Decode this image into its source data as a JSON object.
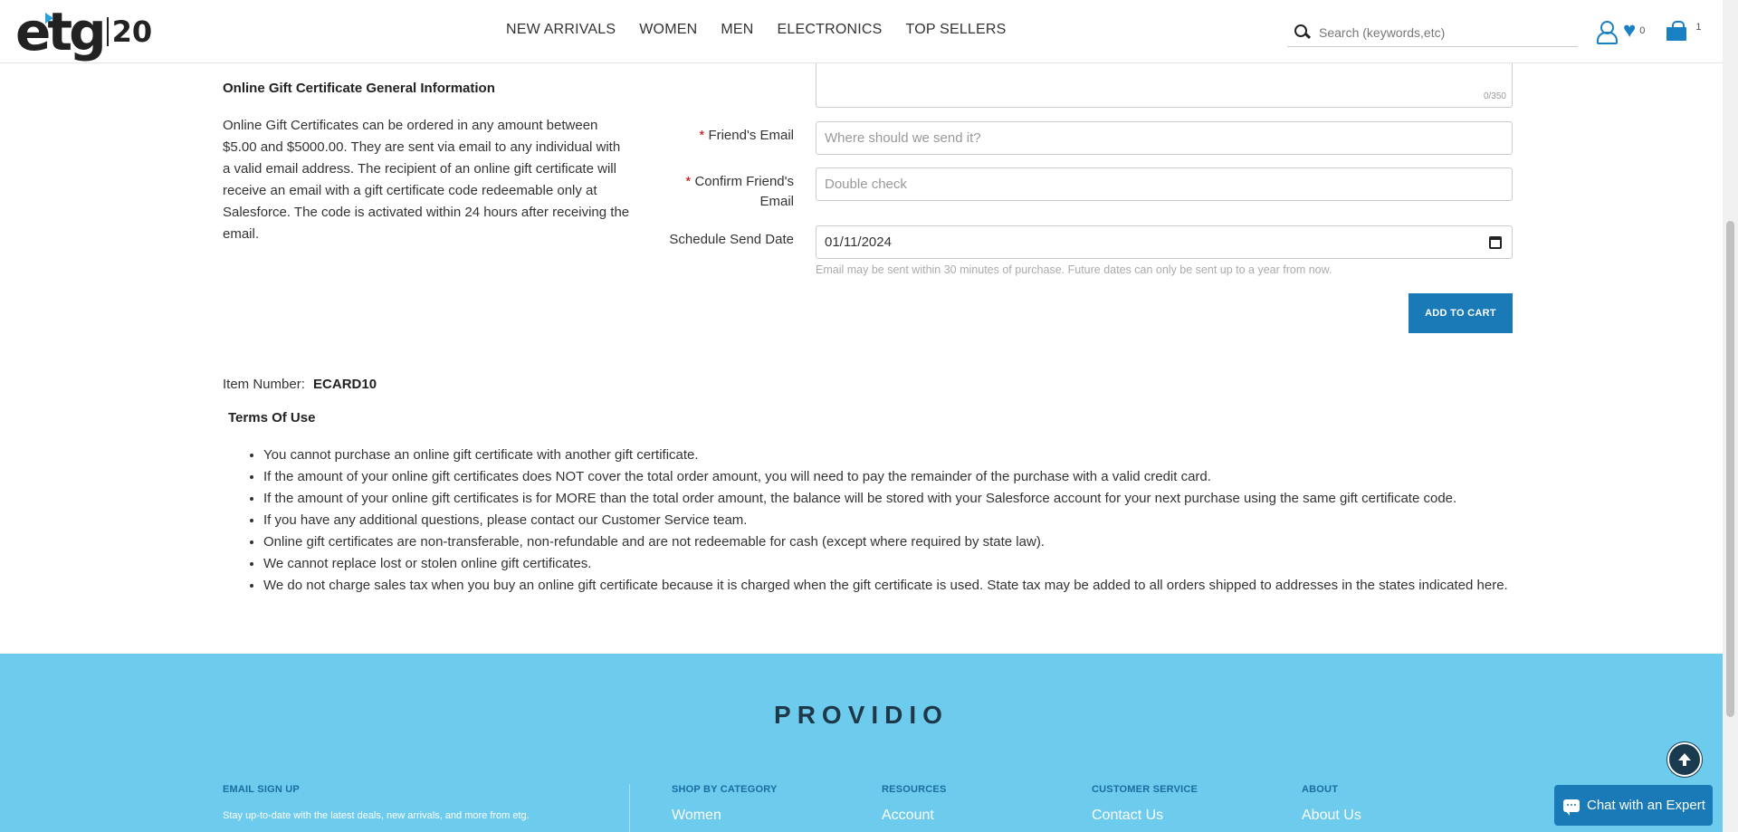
{
  "header": {
    "logo_text": "etg",
    "logo_badge": "20",
    "nav": [
      "NEW ARRIVALS",
      "WOMEN",
      "MEN",
      "ELECTRONICS",
      "TOP SELLERS"
    ],
    "search_placeholder": "Search (keywords,etc)",
    "wishlist_count": "0",
    "cart_count": "1"
  },
  "info": {
    "title": "Online Gift Certificate General Information",
    "text": "Online Gift Certificates can be ordered in any amount between $5.00 and $5000.00. They are sent via email to any individual with a valid email address. The recipient of an online gift certificate will receive an email with a gift certificate code redeemable only at Salesforce. The code is activated within 24 hours after receiving the email."
  },
  "form": {
    "char_count": "0/350",
    "friends_email_label": "Friend's Email",
    "friends_email_placeholder": "Where should we send it?",
    "confirm_email_label": "Confirm Friend's Email",
    "confirm_email_placeholder": "Double check",
    "schedule_label": "Schedule Send Date",
    "schedule_value": "01/11/2024",
    "hint": "Email may be sent within 30 minutes of purchase. Future dates can only be sent up to a year from now.",
    "add_to_cart": "ADD TO CART",
    "required_mark": "*"
  },
  "item": {
    "label": "Item Number:",
    "number": "ECARD10"
  },
  "terms": {
    "title": "Terms Of Use",
    "items": [
      "You cannot purchase an online gift certificate with another gift certificate.",
      "If the amount of your online gift certificates does NOT cover the total order amount, you will need to pay the remainder of the purchase with a valid credit card.",
      "If the amount of your online gift certificates is for MORE than the total order amount, the balance will be stored with your Salesforce account for your next purchase using the same gift certificate code.",
      "If you have any additional questions, please contact our Customer Service team.",
      "Online gift certificates are non-transferable, non-refundable and are not redeemable for cash (except where required by state law).",
      "We cannot replace lost or stolen online gift certificates.",
      "We do not charge sales tax when you buy an online gift certificate because it is charged when the gift certificate is used. State tax may be added to all orders shipped to addresses in the states indicated here."
    ]
  },
  "footer": {
    "brand": "PROVIDIO",
    "email_signup_heading": "EMAIL SIGN UP",
    "email_signup_text": "Stay up-to-date with the latest deals, new arrivals, and more from etg.",
    "columns": [
      {
        "heading": "SHOP BY CATEGORY",
        "link": "Women"
      },
      {
        "heading": "RESOURCES",
        "link": "Account"
      },
      {
        "heading": "CUSTOMER SERVICE",
        "link": "Contact Us"
      },
      {
        "heading": "ABOUT",
        "link": "About Us"
      }
    ],
    "chat_label": "Chat with an Expert"
  },
  "colors": {
    "accent": "#1a7ab8",
    "footer_bg": "#6dcbed",
    "required": "#cc0000"
  }
}
